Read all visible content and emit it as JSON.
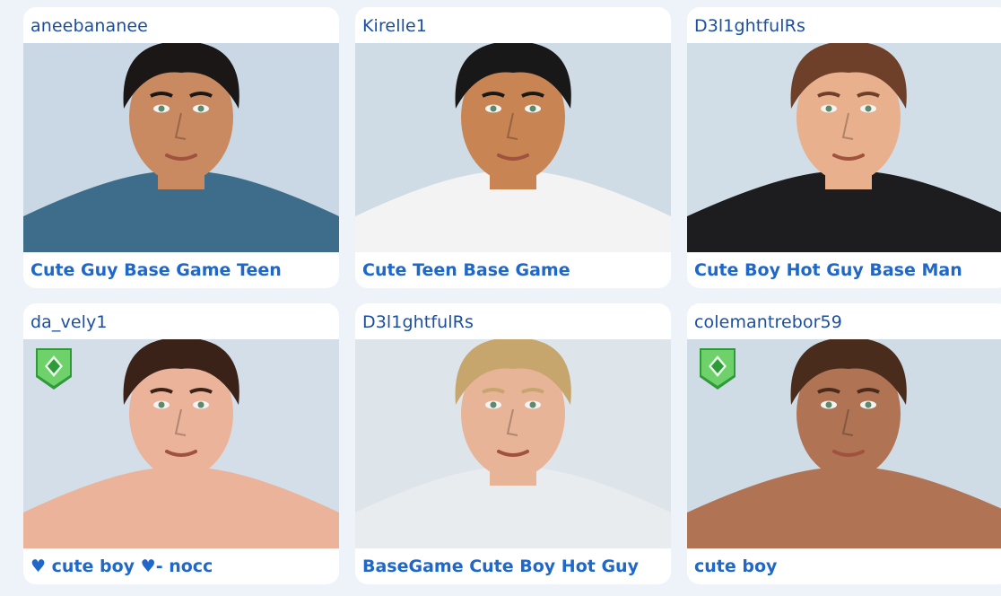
{
  "cards": [
    {
      "creator": "aneebananee",
      "title": "Cute Guy Base Game Teen",
      "badge": false,
      "colors": {
        "bg": "#c9d8e4",
        "skin": "#c98a62",
        "hair": "#1a1716",
        "top": "#3d6d8a"
      }
    },
    {
      "creator": "Kirelle1",
      "title": "Cute Teen Base Game",
      "badge": false,
      "colors": {
        "bg": "#cfdbe5",
        "skin": "#c98454",
        "hair": "#191818",
        "top": "#f3f3f3"
      }
    },
    {
      "creator": "D3l1ghtfulRs",
      "title": "Cute Boy Hot Guy Base Man",
      "badge": false,
      "colors": {
        "bg": "#d1dde7",
        "skin": "#e8b08c",
        "hair": "#6e4029",
        "top": "#1d1d1f"
      }
    },
    {
      "creator": "da_vely1",
      "title": "♥ cute boy ♥- nocc",
      "badge": true,
      "colors": {
        "bg": "#d3dee8",
        "skin": "#eab39a",
        "hair": "#3a2218",
        "top": "#eab39a"
      }
    },
    {
      "creator": "D3l1ghtfulRs",
      "title": "BaseGame Cute Boy Hot Guy",
      "badge": false,
      "colors": {
        "bg": "#dde4ea",
        "skin": "#e8b497",
        "hair": "#c7a66d",
        "top": "#e9ecef"
      }
    },
    {
      "creator": "colemantrebor59",
      "title": "cute boy",
      "badge": true,
      "colors": {
        "bg": "#cfdbe5",
        "skin": "#b07455",
        "hair": "#4a2c1c",
        "top": "#b07455"
      }
    }
  ],
  "badge_colors": {
    "light": "#6fd16a",
    "dark": "#2f9a3a"
  }
}
